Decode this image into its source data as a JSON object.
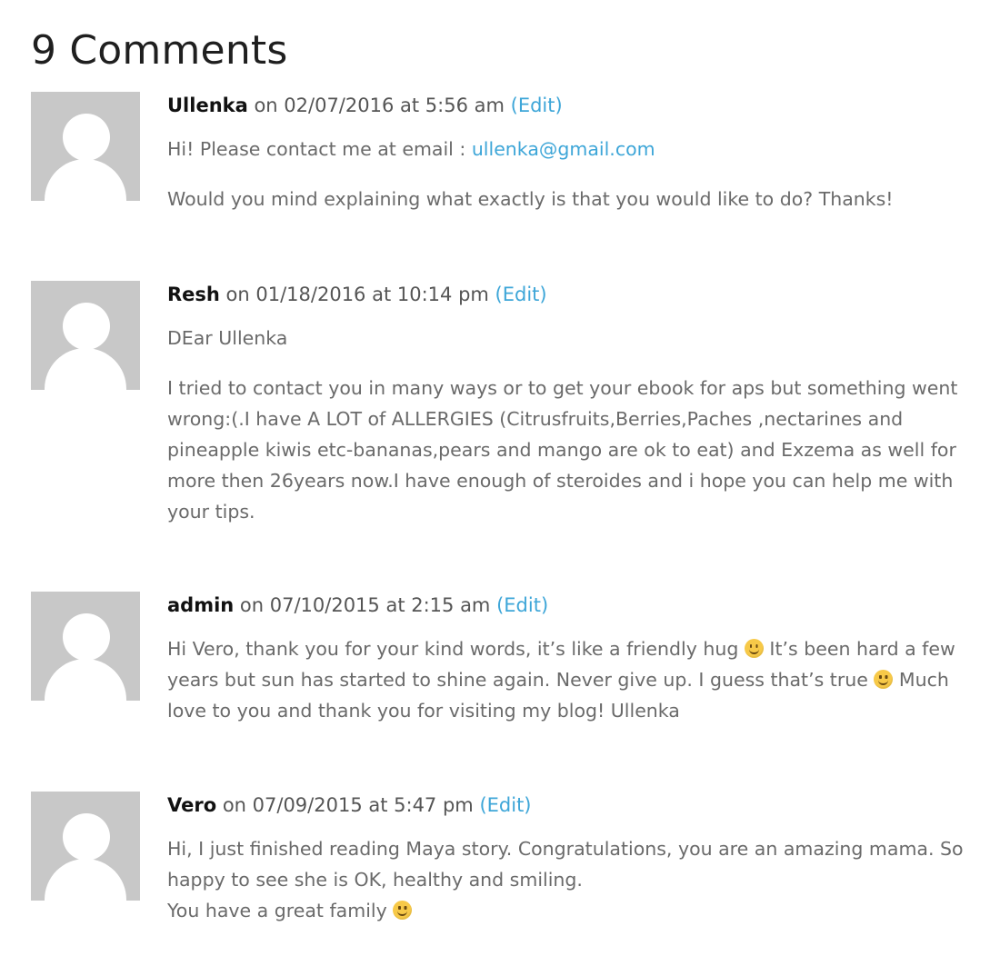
{
  "heading": "9 Comments",
  "edit_label": "(Edit)",
  "comments": [
    {
      "author": "Ullenka",
      "date_text": " on 02/07/2016 at 5:56 am ",
      "p1_prefix": "Hi! Please contact me at email : ",
      "p1_email": "ullenka@gmail.com",
      "p2": "Would you mind explaining what exactly is that you would like to do? Thanks!"
    },
    {
      "author": "Resh",
      "date_text": " on 01/18/2016 at 10:14 pm ",
      "p1": "DEar Ullenka",
      "p2": "I tried to contact you in many ways or to get your ebook for aps but something went wrong:(.I have A LOT of ALLERGIES (Citrusfruits,Berries,Paches ,nectarines and pineapple kiwis etc-bananas,pears and mango are ok to eat) and Exzema as well for more then 26years now.I have enough of steroides and i hope you can help me with your tips."
    },
    {
      "author": "admin",
      "date_text": " on 07/10/2015 at 2:15 am ",
      "p1_a": "Hi Vero, thank you for your kind words, it’s like a friendly hug ",
      "p1_b": " It’s been hard a few years but sun has started to shine again. Never give up. I guess that’s true ",
      "p1_c": " Much love to you and thank you for visiting my blog! Ullenka"
    },
    {
      "author": "Vero",
      "date_text": " on 07/09/2015 at 5:47 pm ",
      "p1_line1": "Hi, I just finished reading Maya story. Congratulations, you are an amazing mama. So happy to see she is OK, healthy and smiling.",
      "p1_line2": "You have a great family "
    }
  ],
  "icons": {
    "avatar": "default-user-avatar-icon",
    "emoji": "slightly-smiling-face-icon"
  },
  "colors": {
    "link": "#3ea6d8",
    "avatar_bg": "#c8c8c8",
    "text": "#6a6a6a",
    "heading": "#1f1f1f"
  }
}
